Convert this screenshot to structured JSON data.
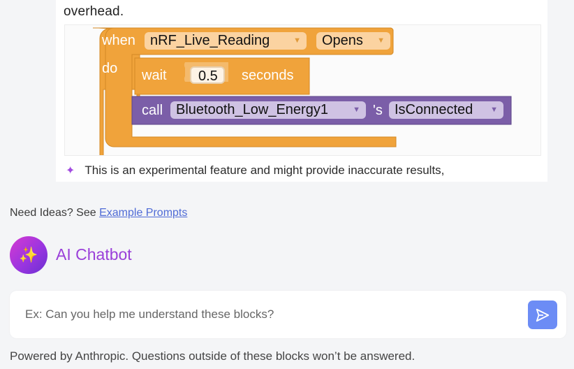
{
  "message": {
    "overhead_text": "overhead.",
    "disclaimer": "This is an experimental feature and might provide inaccurate results,"
  },
  "blocks": {
    "event": {
      "when": "when",
      "component": "nRF_Live_Reading",
      "event_name": "Opens",
      "do": "do"
    },
    "wait": {
      "label": "wait",
      "value": "0.5",
      "unit": "seconds"
    },
    "call": {
      "label": "call",
      "component": "Bluetooth_Low_Energy1",
      "possessive": "'s",
      "method": "IsConnected"
    },
    "dropdown_arrow": "▼",
    "colors": {
      "event": "#f0a33b",
      "control": "#f0a33b",
      "procedure": "#7b5ea8",
      "event_field": "#fbd3a1",
      "procedure_field": "#cfc2e3"
    }
  },
  "ideas": {
    "prefix": "Need Ideas? See ",
    "link": "Example Prompts"
  },
  "chatbot": {
    "title": "AI Chatbot",
    "avatar_icon": "sparkle-icon"
  },
  "input": {
    "placeholder": "Ex: Can you help me understand these blocks?",
    "value": ""
  },
  "footer": {
    "note": "Powered by Anthropic. Questions outside of these blocks won’t be answered."
  }
}
